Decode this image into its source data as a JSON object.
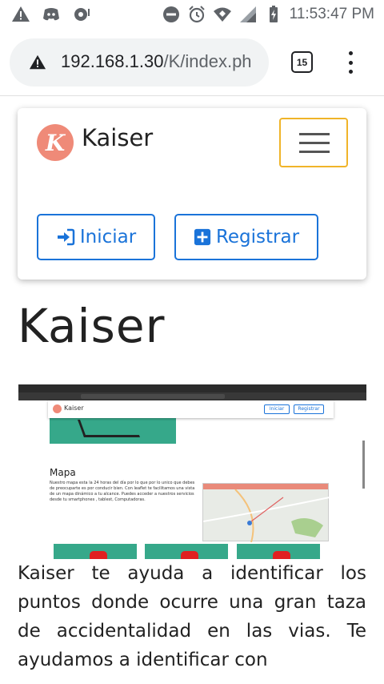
{
  "status_bar": {
    "time": "11:53:47 PM",
    "left_icons": [
      "warning-icon",
      "discord-icon",
      "notification-icon"
    ],
    "right_icons": [
      "do-not-disturb-icon",
      "alarm-icon",
      "wifi-icon",
      "signal-icon",
      "battery-icon"
    ]
  },
  "browser": {
    "url_host": "192.168.1.30",
    "url_path": "/K/index.ph",
    "tab_count": "15"
  },
  "navbar": {
    "brand_initial": "K",
    "brand_name": "Kaiser",
    "login_label": "Iniciar",
    "register_label": "Registrar"
  },
  "hero": {
    "title": "Kaiser"
  },
  "embedded_screenshot": {
    "nav_brand": "Kaiser",
    "nav_login": "Iniciar",
    "nav_register": "Registrar",
    "section_title": "Mapa",
    "section_text": "Nuestro mapa esta la 24 horas del día por lo que por lo unico que debes de preocuparte es por conducir bien. Con leaflet te facilitamos una vista de un mapa dinámico a tu alcance. Puedes acceder a nuestros servicios desde tu smartphones , tablest, Computadoras."
  },
  "body_text": "Kaiser te ayuda a identificar los puntos donde ocurre una gran taza de accidentalidad en las vias. Te ayudamos a identificar con",
  "colors": {
    "accent_blue": "#1a73d9",
    "toggler_border": "#f0b429",
    "logo_bg": "#ef8a78",
    "teal": "#36a88a"
  }
}
